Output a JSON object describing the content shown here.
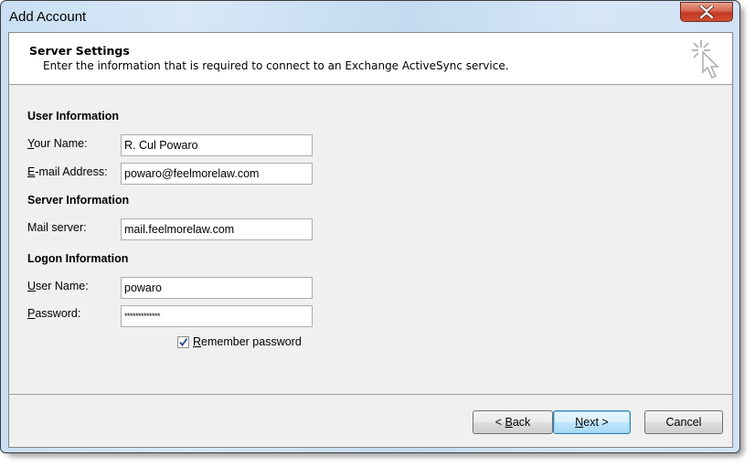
{
  "window": {
    "title": "Add Account",
    "close_icon": "close-x-icon"
  },
  "header": {
    "title": "Server Settings",
    "subtitle": "Enter the information that is required to connect to an Exchange ActiveSync service.",
    "icon": "cursor-click-icon"
  },
  "user_info": {
    "heading": "User Information",
    "your_name": {
      "label_access": "Y",
      "label_rest": "our Name:",
      "value": "R. Cul Powaro"
    },
    "email": {
      "label_access": "E",
      "label_rest": "-mail Address:",
      "value": "powaro@feelmorelaw.com"
    }
  },
  "server_info": {
    "heading": "Server Information",
    "mail_server": {
      "label": "Mail server:",
      "value": "mail.feelmorelaw.com"
    }
  },
  "logon_info": {
    "heading": "Logon Information",
    "user_name": {
      "label_access": "U",
      "label_rest": "ser Name:",
      "value": "powaro"
    },
    "password": {
      "label_access": "P",
      "label_rest": "assword:",
      "value": "*************"
    },
    "remember": {
      "label_access": "R",
      "label_rest": "emember password",
      "checked": true
    }
  },
  "buttons": {
    "back": {
      "prefix": "< ",
      "access": "B",
      "rest": "ack"
    },
    "next": {
      "access": "N",
      "rest": "ext >"
    },
    "cancel": {
      "label": "Cancel"
    }
  }
}
